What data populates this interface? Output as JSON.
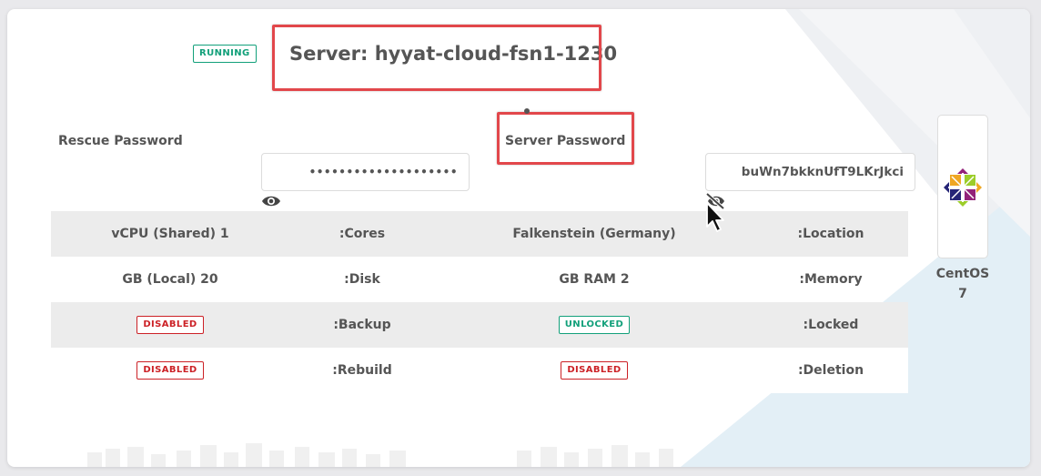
{
  "server": {
    "status": "RUNNING",
    "title": "Server: hyyat-cloud-fsn1-1230"
  },
  "rescue_password": {
    "label": "Rescue Password",
    "value": "••••••••••••••••••••",
    "icon": "eye-icon"
  },
  "server_password": {
    "label": "Server Password",
    "value": "buWn7bkknUfT9LKrJkci",
    "icon": "eye-slash-icon"
  },
  "details": {
    "rows": [
      {
        "v1": "vCPU (Shared) 1",
        "l1": ":Cores",
        "v2": "Falkenstein (Germany)",
        "l2": ":Location"
      },
      {
        "v1": "GB (Local) 20",
        "l1": ":Disk",
        "v2": "GB RAM 2",
        "l2": ":Memory"
      },
      {
        "v1": "DISABLED",
        "l1": ":Backup",
        "v2": "UNLOCKED",
        "l2": ":Locked"
      },
      {
        "v1": "DISABLED",
        "l1": ":Rebuild",
        "v2": "DISABLED",
        "l2": ":Deletion"
      }
    ]
  },
  "os": {
    "name": "CentOS",
    "version": "7",
    "icon": "centos-logo"
  },
  "colors": {
    "accent_green": "#12a07a",
    "accent_red": "#cc2126",
    "highlight": "#e2474b"
  }
}
